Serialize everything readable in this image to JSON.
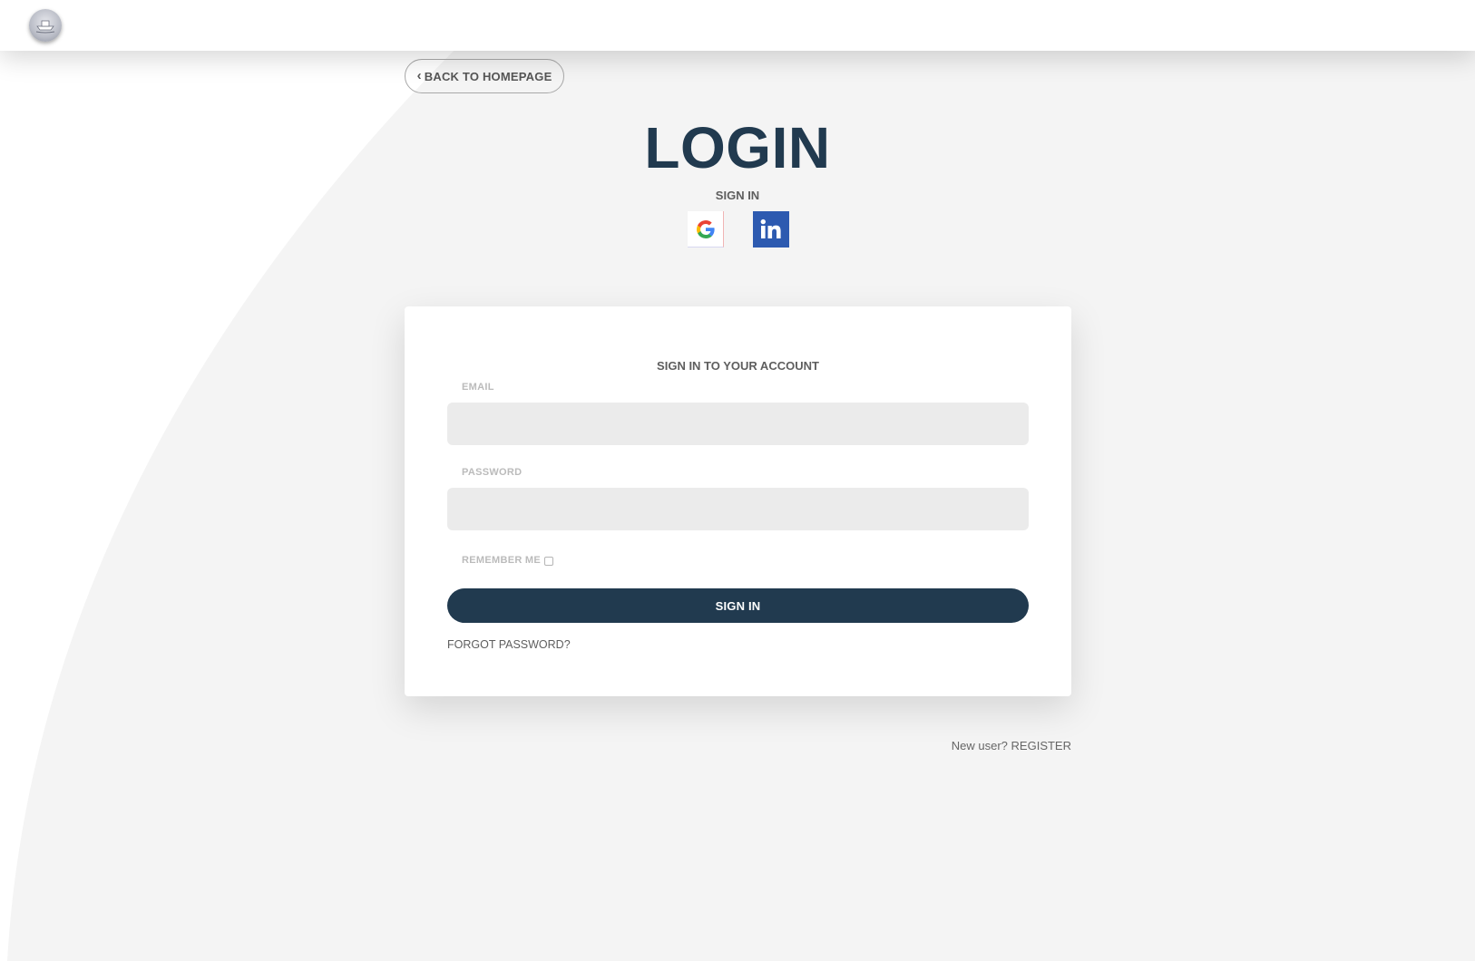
{
  "colors": {
    "primary": "#213a4f",
    "background": "#f4f4f4",
    "linkedin": "#2d5ab0",
    "input_bg": "#ebebeb"
  },
  "header": {
    "logo_icon": "app-logo-icon"
  },
  "nav": {
    "back_label": "BACK TO HOMEPAGE",
    "back_icon": "chevron-left-icon"
  },
  "hero": {
    "title": "LOGIN",
    "subtitle": "SIGN IN"
  },
  "social": [
    {
      "name": "Google",
      "icon": "google-icon"
    },
    {
      "name": "LinkedIn",
      "icon": "linkedin-icon"
    }
  ],
  "form": {
    "heading": "SIGN IN TO YOUR ACCOUNT",
    "email_label": "EMAIL",
    "email_value": "",
    "password_label": "PASSWORD",
    "password_value": "",
    "remember_label": "REMEMBER ME",
    "submit_label": "SIGN IN",
    "forgot_label": "FORGOT PASSWORD?"
  },
  "footer": {
    "new_user_text": "New user?",
    "register_label": "REGISTER"
  }
}
